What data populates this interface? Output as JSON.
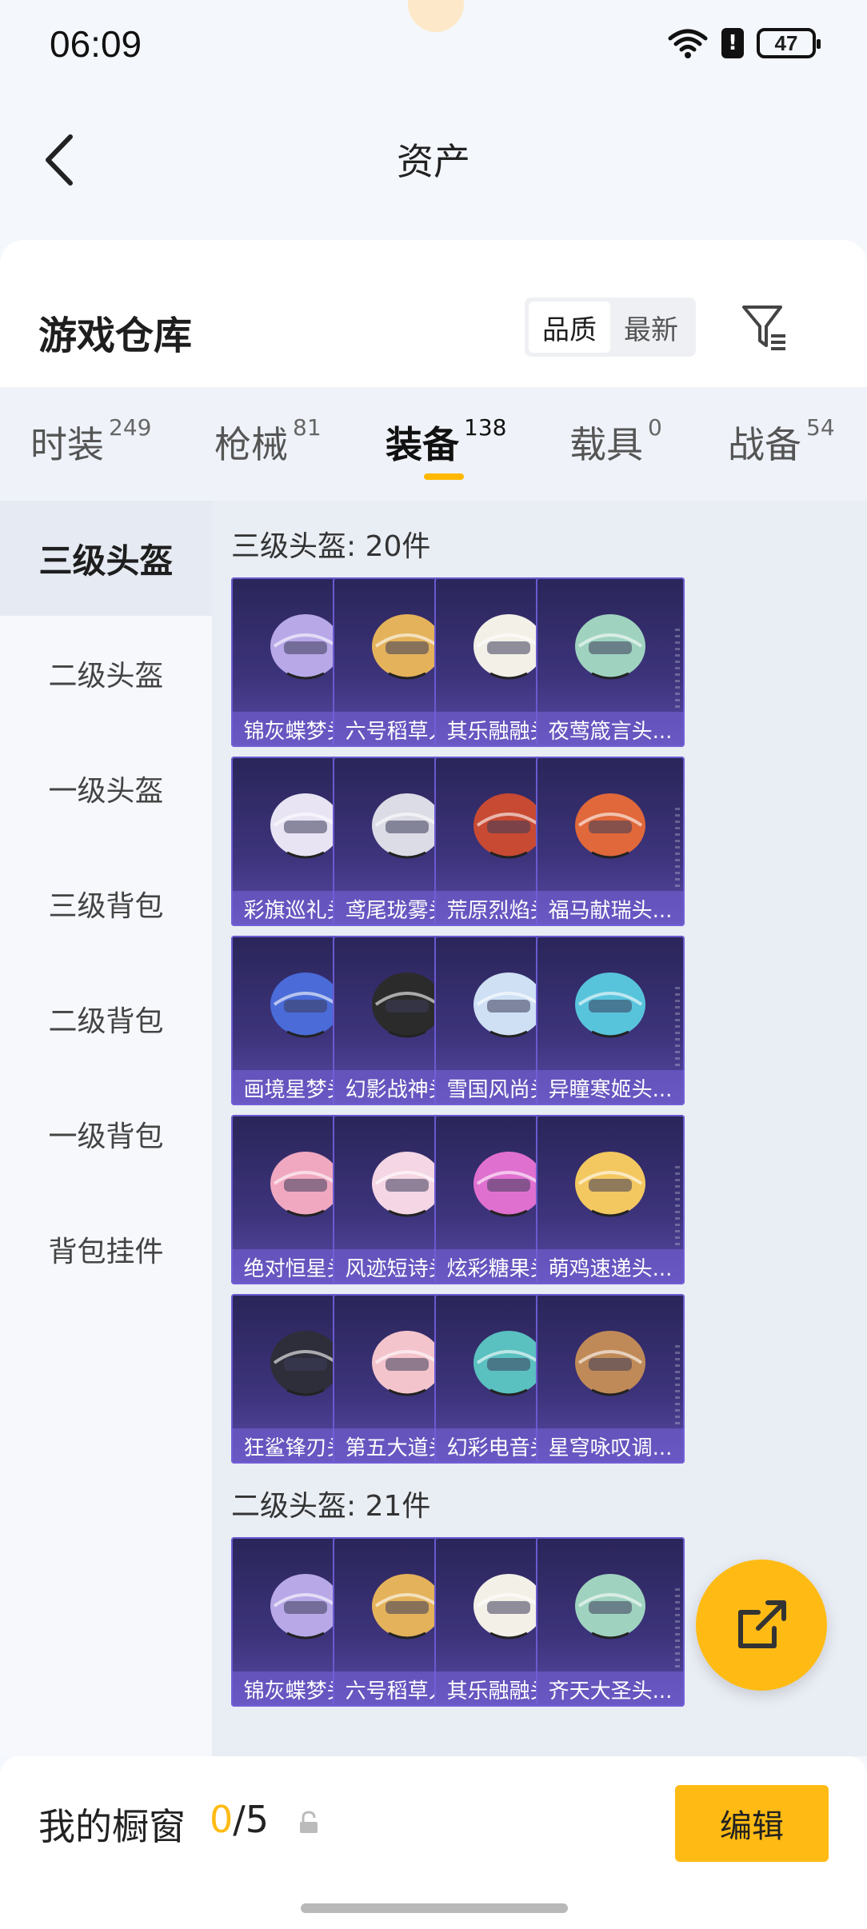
{
  "status_bar": {
    "time": "06:09",
    "battery": "47",
    "icons": [
      "wifi-icon",
      "alert-icon",
      "battery-icon"
    ]
  },
  "header": {
    "title": "资产",
    "back_icon": "chevron-left-icon"
  },
  "section": {
    "title": "游戏仓库",
    "sort_options": [
      "品质",
      "最新"
    ],
    "sort_selected": "品质",
    "filter_icon": "filter-icon"
  },
  "tabs": [
    {
      "label": "时装",
      "count": "249"
    },
    {
      "label": "枪械",
      "count": "81"
    },
    {
      "label": "装备",
      "count": "138"
    },
    {
      "label": "载具",
      "count": "0"
    },
    {
      "label": "战备",
      "count": "54"
    }
  ],
  "active_tab": "装备",
  "sidebar": {
    "items": [
      "三级头盔",
      "二级头盔",
      "一级头盔",
      "三级背包",
      "二级背包",
      "一级背包",
      "背包挂件"
    ],
    "active": "三级头盔"
  },
  "groups": [
    {
      "title": "三级头盔: 20件",
      "items": [
        "锦灰蝶梦头...",
        "六号稻草人...",
        "其乐融融头...",
        "夜莺箴言头...",
        "彩旗巡礼头...",
        "鸢尾珑雾头...",
        "荒原烈焰头...",
        "福马献瑞头...",
        "画境星梦头...",
        "幻影战神头...",
        "雪国风尚头...",
        "异瞳寒姬头...",
        "绝对恒星头...",
        "风迹短诗头...",
        "炫彩糖果头...",
        "萌鸡速递头...",
        "狂鲨锋刃头...",
        "第五大道头...",
        "幻彩电音头...",
        "星穹咏叹调..."
      ]
    },
    {
      "title": "二级头盔: 21件",
      "items": [
        "锦灰蝶梦头...",
        "六号稻草人...",
        "其乐融融头...",
        "齐天大圣头..."
      ]
    }
  ],
  "colors": {
    "accent": "#ffbb14",
    "card_bg": "#3d347c",
    "page_bg": "#f4f7fb"
  },
  "fab": {
    "icon": "share-export-icon"
  },
  "bottom": {
    "showcase_label": "我的橱窗",
    "showcase_current": "0",
    "showcase_total": "/5",
    "lock_icon": "lock-icon",
    "edit_label": "编辑"
  }
}
